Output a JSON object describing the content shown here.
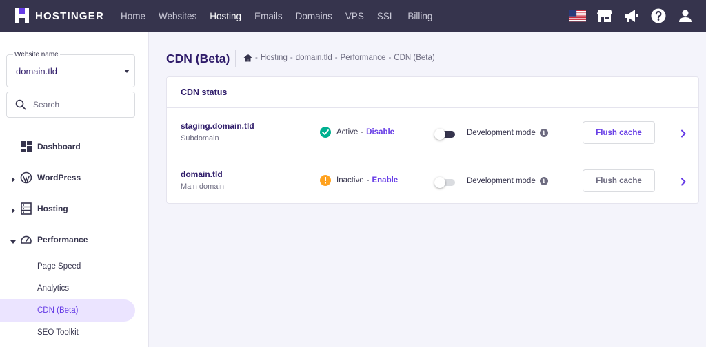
{
  "brand": {
    "name": "HOSTINGER"
  },
  "nav": [
    {
      "label": "Home",
      "active": false
    },
    {
      "label": "Websites",
      "active": false
    },
    {
      "label": "Hosting",
      "active": true
    },
    {
      "label": "Emails",
      "active": false
    },
    {
      "label": "Domains",
      "active": false
    },
    {
      "label": "VPS",
      "active": false
    },
    {
      "label": "SSL",
      "active": false
    },
    {
      "label": "Billing",
      "active": false
    }
  ],
  "top_icons": [
    "us-flag-icon",
    "store-icon",
    "megaphone-icon",
    "help-icon",
    "account-icon"
  ],
  "sidebar": {
    "site_select": {
      "label": "Website name",
      "value": "domain.tld"
    },
    "search": {
      "placeholder": "Search"
    },
    "items": [
      {
        "label": "Dashboard",
        "icon": "dashboard-icon",
        "expandable": false
      },
      {
        "label": "WordPress",
        "icon": "wordpress-icon",
        "expandable": true,
        "expanded": false
      },
      {
        "label": "Hosting",
        "icon": "server-icon",
        "expandable": true,
        "expanded": false
      },
      {
        "label": "Performance",
        "icon": "speedometer-icon",
        "expandable": true,
        "expanded": true
      }
    ],
    "sub_items": [
      {
        "label": "Page Speed",
        "active": false
      },
      {
        "label": "Analytics",
        "active": false
      },
      {
        "label": "CDN (Beta)",
        "active": true
      },
      {
        "label": "SEO Toolkit",
        "active": false
      }
    ]
  },
  "page": {
    "title": "CDN (Beta)",
    "breadcrumb": [
      "Hosting",
      "domain.tld",
      "Performance",
      "CDN (Beta)"
    ],
    "breadcrumb_separator": "-"
  },
  "card": {
    "title": "CDN status",
    "rows": [
      {
        "domain": "staging.domain.tld",
        "type": "Subdomain",
        "status": "Active",
        "status_color": "#00b090",
        "action": "Disable",
        "dev_mode_label": "Development mode",
        "dev_mode_on": true,
        "flush_label": "Flush cache",
        "flush_enabled": true
      },
      {
        "domain": "domain.tld",
        "type": "Main domain",
        "status": "Inactive",
        "status_color": "#ffa21f",
        "action": "Enable",
        "dev_mode_label": "Development mode",
        "dev_mode_on": false,
        "flush_label": "Flush cache",
        "flush_enabled": false
      }
    ]
  },
  "colors": {
    "topbar": "#36344d",
    "accent": "#673de6",
    "active_status": "#00b090",
    "inactive_status": "#ffa21f",
    "sidebar_active_bg": "#ebe4ff"
  }
}
